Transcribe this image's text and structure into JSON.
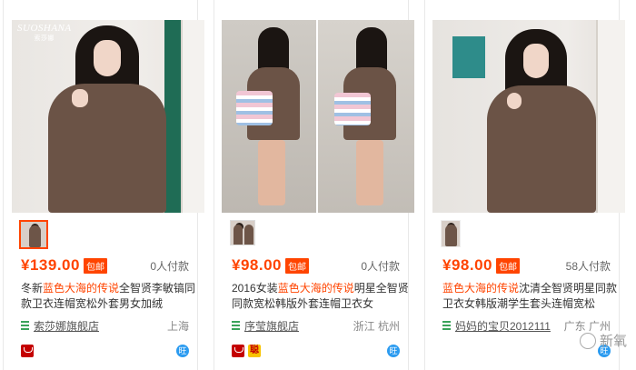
{
  "products": [
    {
      "logo": "SUOSHANA",
      "logo_sub": "索莎娜",
      "price": "¥139.00",
      "badge": "包邮",
      "sold": "0人付款",
      "title_pre": "冬新",
      "title_hl": "蓝色大海的传说",
      "title_post": "全智贤李敏镐同款卫衣连帽宽松外套男女加绒",
      "shop": "索莎娜旗舰店",
      "location": "上海",
      "icons": [
        "tmall-icon",
        "wangwang-icon"
      ]
    },
    {
      "price": "¥98.00",
      "badge": "包邮",
      "sold": "0人付款",
      "title_pre": "2016女装",
      "title_hl": "蓝色大海的传说",
      "title_post": "明星全智贤同款宽松韩版外套连帽卫衣女",
      "shop": "序莹旗舰店",
      "location": "浙江 杭州",
      "gold_label": "聪",
      "icons": [
        "tmall-icon",
        "gold-shop-icon",
        "wangwang-icon"
      ]
    },
    {
      "price": "¥98.00",
      "badge": "包邮",
      "sold": "58人付款",
      "title_pre": "",
      "title_hl": "蓝色大海的传说",
      "title_post": "沈清全智贤明星同款卫衣女韩版潮学生套头连帽宽松",
      "shop": "妈妈的宝贝2012111",
      "location": "广东 广州",
      "icons": [
        "wangwang-icon"
      ]
    }
  ],
  "watermark": "新氧",
  "wang_label": "旺",
  "colors": {
    "accent": "#ff4400",
    "shop_green": "#3aa35a",
    "tmall_red": "#c40000"
  }
}
